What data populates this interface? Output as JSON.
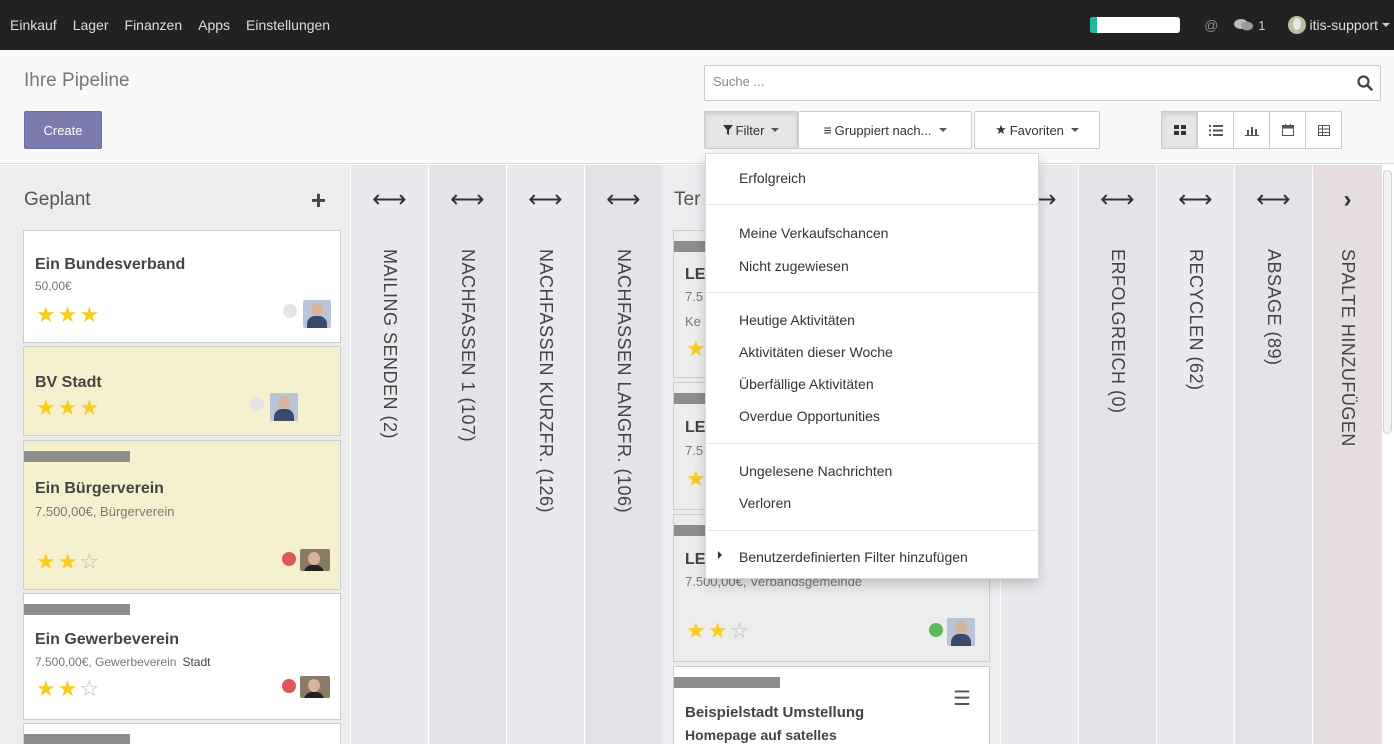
{
  "navbar": {
    "menu": [
      "Einkauf",
      "Lager",
      "Finanzen",
      "Apps",
      "Einstellungen"
    ],
    "progress_fraction": 0.08,
    "chat_count": "1",
    "user": "itis-support"
  },
  "control": {
    "title": "Ihre Pipeline",
    "create_label": "Create",
    "search_placeholder": "Suche ...",
    "filter_label": "Filter",
    "group_label": "Gruppiert nach...",
    "favorites_label": "Favoriten"
  },
  "kanban": {
    "col_geplant": "Geplant",
    "col_termin_partial": "Ter",
    "folded": [
      "MAILING SENDEN (2)",
      "NACHFASSEN 1 (107)",
      "NACHFASSEN KURZFR. (126)",
      "NACHFASSEN LANGFR. (106)",
      "ERFOLGREICH (0)",
      "RECYCLEN (62)",
      "ABSAGE (89)",
      "SPALTE HINZUFÜGEN"
    ],
    "cards": [
      {
        "title": "Ein Bundesverband",
        "subtitle": "50,00€",
        "stars": 3
      },
      {
        "title": "BV Stadt",
        "stars": 3
      },
      {
        "title": "Ein Bürgerverein",
        "subtitle": "7.500,00€, Bürgerverein",
        "stars": 2
      },
      {
        "title": "Ein Gewerbeverein",
        "subtitle": "7.500,00€, Gewerbeverein",
        "tag": "Stadt",
        "stars": 2
      }
    ],
    "termin_cards": [
      {
        "title": "LE",
        "line1": "7.5",
        "line2": "Ke"
      },
      {
        "title": "LE",
        "line1": "7.5"
      },
      {
        "title": "LE",
        "line1": "7.500,00€, Verbandsgemeinde",
        "stars": 2
      },
      {
        "title": "Beispielstadt Umstellung",
        "line2": "Homepage auf satelles"
      }
    ]
  },
  "filter_dropdown": {
    "groups": [
      [
        "Erfolgreich"
      ],
      [
        "Meine Verkaufschancen",
        "Nicht zugewiesen"
      ],
      [
        "Heutige Aktivitäten",
        "Aktivitäten dieser Woche",
        "Überfällige Aktivitäten",
        "Overdue Opportunities"
      ],
      [
        "Ungelesene Nachrichten",
        "Verloren"
      ],
      [
        "Benutzerdefinierten Filter hinzufügen"
      ]
    ]
  },
  "colors": {
    "accent": "#7c7bad",
    "star": "#f7cd1f",
    "dot_red": "#e05757",
    "dot_green": "#5cb85c",
    "dot_gray": "#e4e4e4"
  }
}
